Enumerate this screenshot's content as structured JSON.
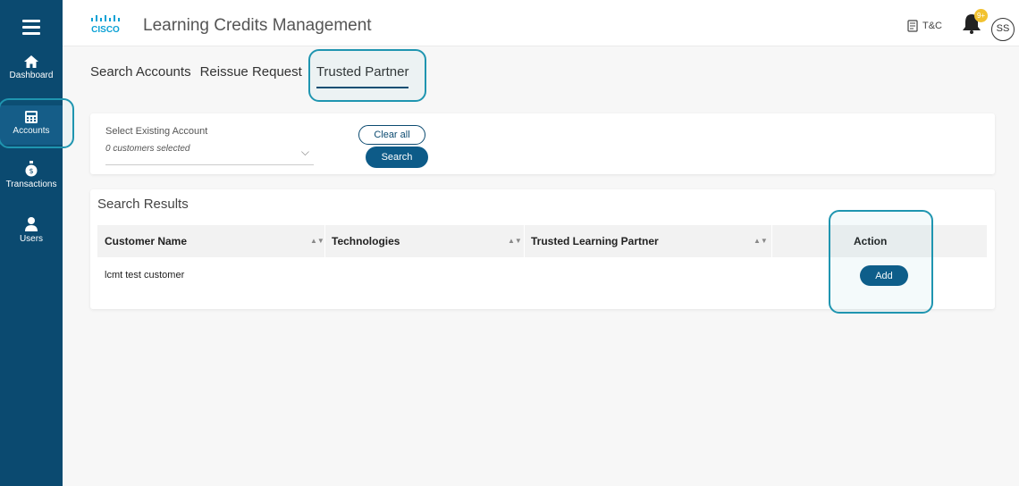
{
  "header": {
    "app_title": "Learning Credits Management",
    "logo_text": "CISCO",
    "tc_label": "T&C",
    "notification_badge": "9+",
    "avatar_initials": "SS"
  },
  "sidebar": {
    "items": [
      {
        "label": "Dashboard",
        "icon": "home-icon"
      },
      {
        "label": "Accounts",
        "icon": "calculator-icon"
      },
      {
        "label": "Transactions",
        "icon": "money-bag-icon"
      },
      {
        "label": "Users",
        "icon": "user-icon"
      }
    ],
    "active": "Accounts"
  },
  "tabs": [
    {
      "label": "Search Accounts"
    },
    {
      "label": "Reissue Request"
    },
    {
      "label": "Trusted Partner"
    }
  ],
  "filter": {
    "label": "Select Existing Account",
    "select_value": "0 customers selected",
    "clear_label": "Clear all",
    "search_label": "Search"
  },
  "results": {
    "title": "Search Results",
    "columns": [
      "Customer Name",
      "Technologies",
      "Trusted Learning Partner",
      "Action"
    ],
    "rows": [
      {
        "customer_name": "lcmt test customer",
        "action_label": "Add"
      }
    ]
  },
  "colors": {
    "sidebar": "#0b4a70",
    "primary_button": "#0d5b88",
    "highlight": "#1f95b0",
    "badge": "#f2c230"
  }
}
